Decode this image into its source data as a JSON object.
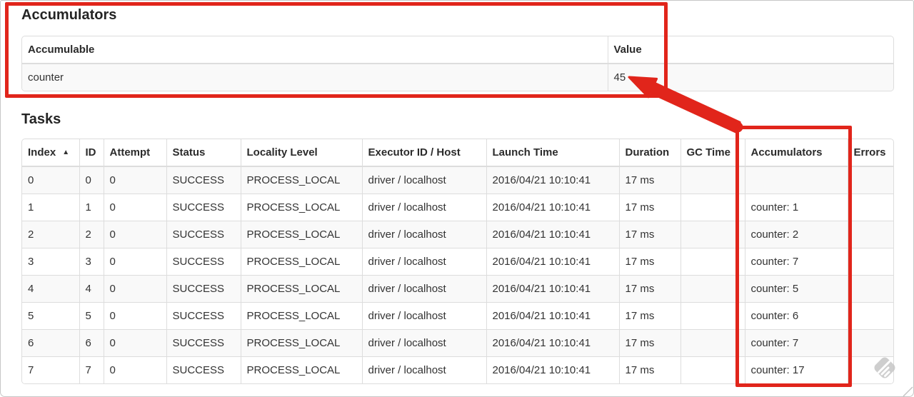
{
  "accumulators_section": {
    "title": "Accumulators",
    "table": {
      "columns": [
        {
          "label": "Accumulable"
        },
        {
          "label": "Value"
        }
      ],
      "row": {
        "accumulable": "counter",
        "value": "45"
      }
    }
  },
  "tasks_section": {
    "title": "Tasks",
    "table": {
      "columns": [
        {
          "key": "index",
          "label": "Index",
          "sort_indicator": "▲"
        },
        {
          "key": "id",
          "label": "ID"
        },
        {
          "key": "attempt",
          "label": "Attempt"
        },
        {
          "key": "status",
          "label": "Status"
        },
        {
          "key": "locality",
          "label": "Locality Level"
        },
        {
          "key": "executor",
          "label": "Executor ID / Host"
        },
        {
          "key": "launch",
          "label": "Launch Time"
        },
        {
          "key": "duration",
          "label": "Duration"
        },
        {
          "key": "gc_time",
          "label": "GC Time"
        },
        {
          "key": "accumulators",
          "label": "Accumulators"
        },
        {
          "key": "errors",
          "label": "Errors"
        }
      ],
      "rows": [
        {
          "index": "0",
          "id": "0",
          "attempt": "0",
          "status": "SUCCESS",
          "locality": "PROCESS_LOCAL",
          "executor": "driver / localhost",
          "launch": "2016/04/21 10:10:41",
          "duration": "17 ms",
          "gc_time": "",
          "accumulators": "",
          "errors": ""
        },
        {
          "index": "1",
          "id": "1",
          "attempt": "0",
          "status": "SUCCESS",
          "locality": "PROCESS_LOCAL",
          "executor": "driver / localhost",
          "launch": "2016/04/21 10:10:41",
          "duration": "17 ms",
          "gc_time": "",
          "accumulators": "counter: 1",
          "errors": ""
        },
        {
          "index": "2",
          "id": "2",
          "attempt": "0",
          "status": "SUCCESS",
          "locality": "PROCESS_LOCAL",
          "executor": "driver / localhost",
          "launch": "2016/04/21 10:10:41",
          "duration": "17 ms",
          "gc_time": "",
          "accumulators": "counter: 2",
          "errors": ""
        },
        {
          "index": "3",
          "id": "3",
          "attempt": "0",
          "status": "SUCCESS",
          "locality": "PROCESS_LOCAL",
          "executor": "driver / localhost",
          "launch": "2016/04/21 10:10:41",
          "duration": "17 ms",
          "gc_time": "",
          "accumulators": "counter: 7",
          "errors": ""
        },
        {
          "index": "4",
          "id": "4",
          "attempt": "0",
          "status": "SUCCESS",
          "locality": "PROCESS_LOCAL",
          "executor": "driver / localhost",
          "launch": "2016/04/21 10:10:41",
          "duration": "17 ms",
          "gc_time": "",
          "accumulators": "counter: 5",
          "errors": ""
        },
        {
          "index": "5",
          "id": "5",
          "attempt": "0",
          "status": "SUCCESS",
          "locality": "PROCESS_LOCAL",
          "executor": "driver / localhost",
          "launch": "2016/04/21 10:10:41",
          "duration": "17 ms",
          "gc_time": "",
          "accumulators": "counter: 6",
          "errors": ""
        },
        {
          "index": "6",
          "id": "6",
          "attempt": "0",
          "status": "SUCCESS",
          "locality": "PROCESS_LOCAL",
          "executor": "driver / localhost",
          "launch": "2016/04/21 10:10:41",
          "duration": "17 ms",
          "gc_time": "",
          "accumulators": "counter: 7",
          "errors": ""
        },
        {
          "index": "7",
          "id": "7",
          "attempt": "0",
          "status": "SUCCESS",
          "locality": "PROCESS_LOCAL",
          "executor": "driver / localhost",
          "launch": "2016/04/21 10:10:41",
          "duration": "17 ms",
          "gc_time": "",
          "accumulators": "counter: 17",
          "errors": ""
        }
      ]
    }
  },
  "annotations": {
    "color": "#e1251b"
  },
  "watermark": {
    "icon": "feedly-icon",
    "color": "#c6c6c6"
  }
}
